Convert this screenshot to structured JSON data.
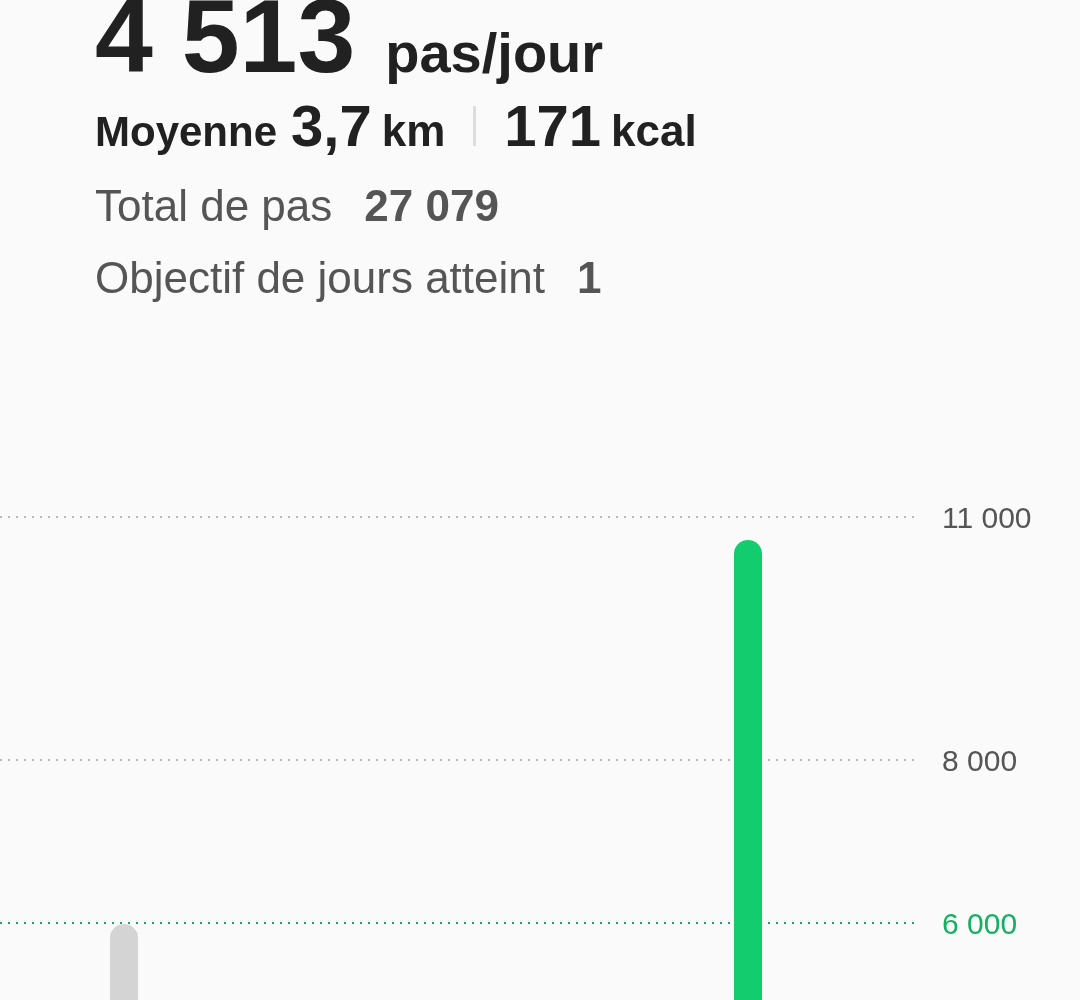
{
  "summary": {
    "average_steps": "4 513",
    "unit": "pas/jour",
    "average_label": "Moyenne",
    "distance_value": "3,7",
    "distance_unit": "km",
    "calories_value": "171",
    "calories_unit": "kcal"
  },
  "stats": [
    {
      "label": "Total de pas",
      "value": "27 079"
    },
    {
      "label": "Objectif de jours atteint",
      "value": "1"
    }
  ],
  "chart": {
    "gridlines": [
      {
        "label": "11 000",
        "kind": "grid"
      },
      {
        "label": "8 000",
        "kind": "grid"
      },
      {
        "label": "6 000",
        "kind": "goal"
      }
    ]
  }
}
